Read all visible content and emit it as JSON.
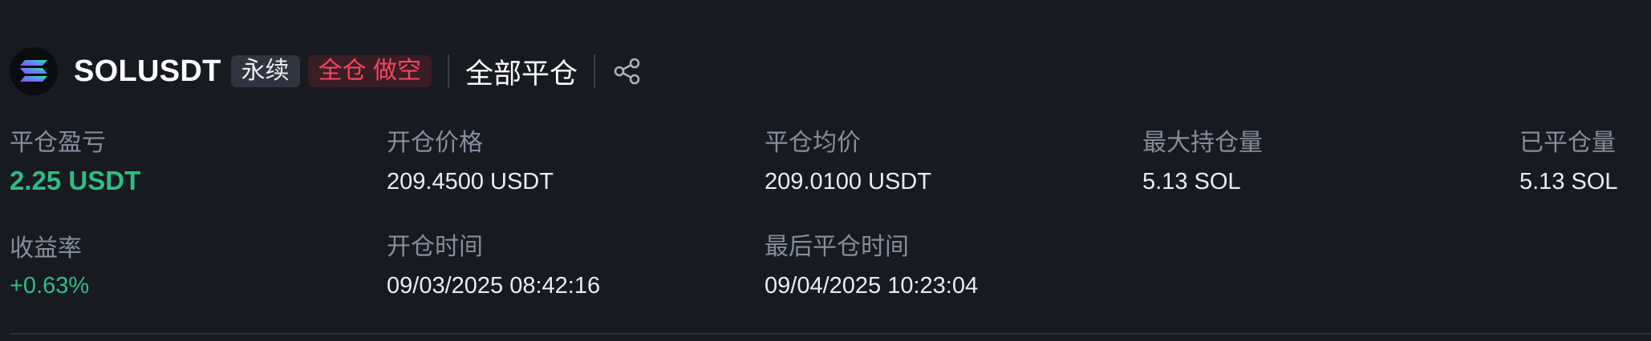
{
  "header": {
    "symbol": "SOLUSDT",
    "contract_type": "永续",
    "margin_side": "全仓 做空",
    "close_all_label": "全部平仓",
    "coin_icon": "solana-logo-icon",
    "share_icon": "share-icon"
  },
  "stats": {
    "pnl": {
      "label": "平仓盈亏",
      "value": "2.25 USDT"
    },
    "entry_price": {
      "label": "开仓价格",
      "value": "209.4500 USDT"
    },
    "avg_close_price": {
      "label": "平仓均价",
      "value": "209.0100 USDT"
    },
    "max_position": {
      "label": "最大持仓量",
      "value": "5.13 SOL"
    },
    "closed_volume": {
      "label": "已平仓量",
      "value": "5.13 SOL"
    },
    "roi": {
      "label": "收益率",
      "value": "+0.63%"
    },
    "open_time": {
      "label": "开仓时间",
      "value": "09/03/2025 08:42:16"
    },
    "last_close_time": {
      "label": "最后平仓时间",
      "value": "09/04/2025 10:23:04"
    }
  },
  "colors": {
    "background": "#181a21",
    "profit": "#2ebd85",
    "short": "#f6465d",
    "label": "#848e9c"
  }
}
